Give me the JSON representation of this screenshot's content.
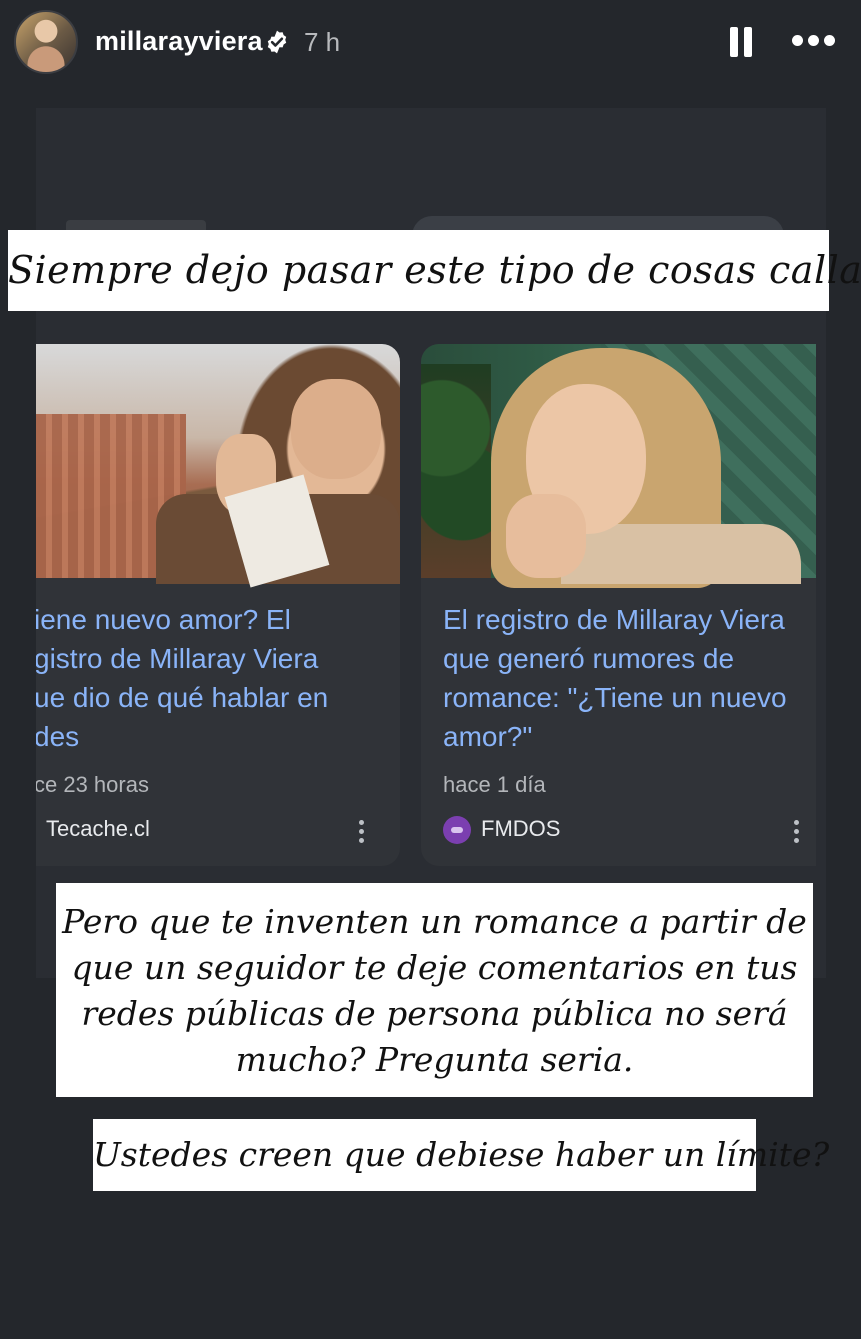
{
  "header": {
    "username": "millarayviera",
    "time_ago": "7 h",
    "verified": true,
    "icons": [
      "verified-badge-icon",
      "pause-icon",
      "more-options-icon"
    ]
  },
  "stickers": {
    "top": "Siempre dejo pasar este tipo de cosas calladita",
    "middle": "Pero que te inventen un romance a partir de que un seguidor te deje comentarios en tus redes públicas de persona pública no será mucho? Pregunta seria.",
    "bottom": "Ustedes creen que debiese haber un límite?"
  },
  "cards": [
    {
      "title": "iene nuevo amor? El\ngistro de Millaray Viera\nue dio de qué hablar en\ndes",
      "date": "ce 23 horas",
      "source": "Tecache.cl"
    },
    {
      "title": "El registro de Millaray Viera que generó rumores de romance: \"¿Tiene un nuevo amor?\"",
      "date": "hace 1 día",
      "source": "FMDOS"
    }
  ],
  "colors": {
    "background": "#24272c",
    "card": "#303338",
    "link_blue": "#8ab4f8",
    "sticker_bg": "#ffffff"
  }
}
